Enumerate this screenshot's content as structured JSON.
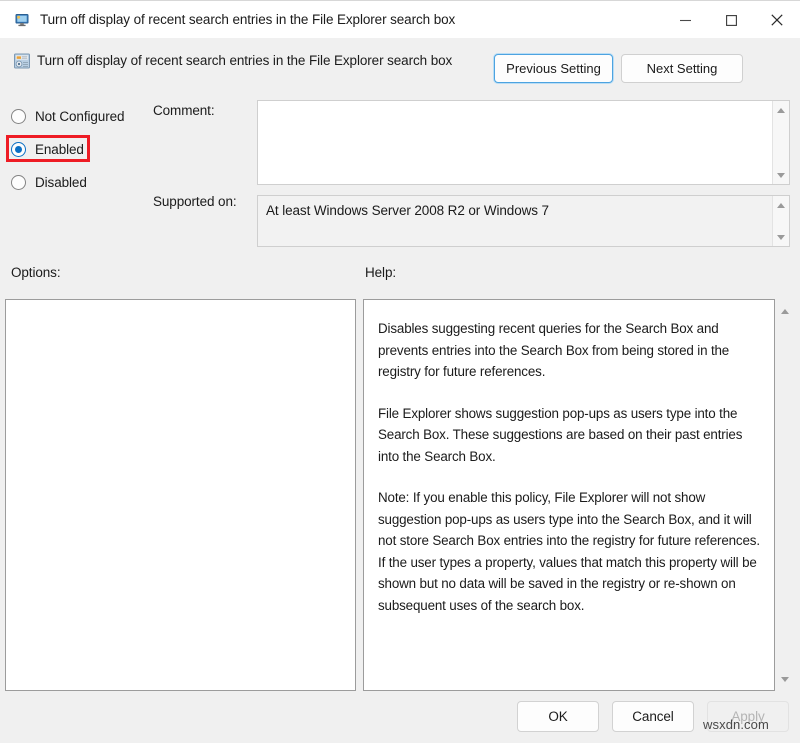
{
  "window": {
    "title": "Turn off display of recent search entries in the File Explorer search box",
    "icon": "policy-monitor-icon",
    "controls": {
      "minimize": "minimize-icon",
      "maximize": "maximize-icon",
      "close": "close-icon"
    }
  },
  "header": {
    "icon": "policy-setting-icon",
    "title": "Turn off display of recent search entries in the File Explorer search box",
    "previous_setting_label": "Previous Setting",
    "next_setting_label": "Next Setting"
  },
  "state": {
    "options": [
      {
        "id": "not-configured",
        "label": "Not Configured",
        "selected": false
      },
      {
        "id": "enabled",
        "label": "Enabled",
        "selected": true
      },
      {
        "id": "disabled",
        "label": "Disabled",
        "selected": false
      }
    ],
    "selected": "Enabled",
    "highlight_color": "#ee1c25"
  },
  "fields": {
    "comment_label": "Comment:",
    "comment_value": "",
    "supported_on_label": "Supported on:",
    "supported_on_value": "At least Windows Server 2008 R2 or Windows 7"
  },
  "panels": {
    "options_label": "Options:",
    "options_content": "",
    "help_label": "Help:",
    "help_paragraphs": [
      "Disables suggesting recent queries for the Search Box and prevents entries into the Search Box from being stored in the registry for future references.",
      "File Explorer shows suggestion pop-ups as users type into the Search Box.  These suggestions are based on their past entries into the Search Box.",
      "Note: If you enable this policy, File Explorer will not show suggestion pop-ups as users type into the Search Box, and it will not store Search Box entries into the registry for future references.  If the user types a property, values that match this property will be shown but no data will be saved in the registry or re-shown on subsequent uses of the search box."
    ]
  },
  "footer": {
    "ok_label": "OK",
    "cancel_label": "Cancel",
    "apply_label": "Apply",
    "apply_enabled": false
  },
  "watermark": "wsxdn.com"
}
